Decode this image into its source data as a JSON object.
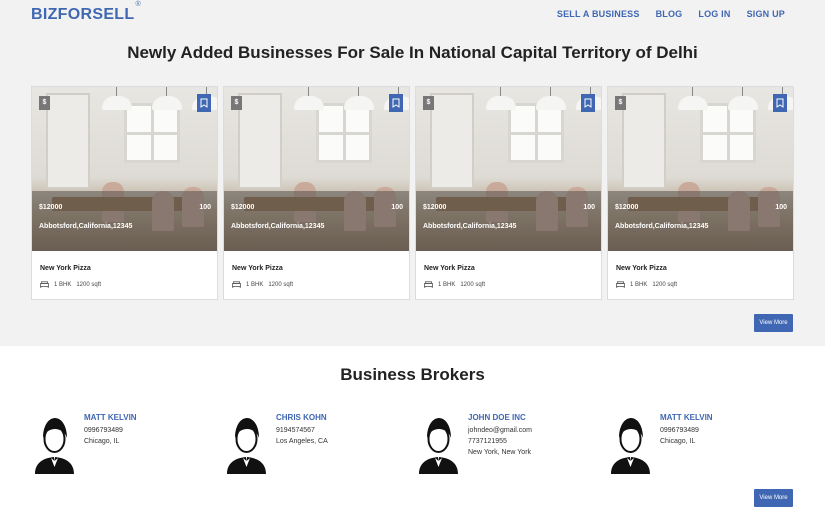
{
  "header": {
    "logo": "BIZFORSELL",
    "logo_mark": "®",
    "nav": [
      "SELL A BUSINESS",
      "BLOG",
      "LOG IN",
      "SIGN UP"
    ]
  },
  "listings": {
    "title": "Newly Added Businesses For Sale In National Capital Territory of Delhi",
    "cards": [
      {
        "badge": "$",
        "price": "$12000",
        "count": "100",
        "address": "Abbotsford,California,12345",
        "name": "New York Pizza",
        "bhk": "1 BHK",
        "area": "1200 sqft"
      },
      {
        "badge": "$",
        "price": "$12000",
        "count": "100",
        "address": "Abbotsford,California,12345",
        "name": "New York Pizza",
        "bhk": "1 BHK",
        "area": "1200 sqft"
      },
      {
        "badge": "$",
        "price": "$12000",
        "count": "100",
        "address": "Abbotsford,California,12345",
        "name": "New York Pizza",
        "bhk": "1 BHK",
        "area": "1200 sqft"
      },
      {
        "badge": "$",
        "price": "$12000",
        "count": "100",
        "address": "Abbotsford,California,12345",
        "name": "New York Pizza",
        "bhk": "1 BHK",
        "area": "1200 sqft"
      }
    ],
    "view_more": "View More"
  },
  "brokers": {
    "title": "Business Brokers",
    "items": [
      {
        "name": "MATT KELVIN",
        "lines": [
          "0996793489",
          "Chicago, IL"
        ]
      },
      {
        "name": "CHRIS KOHN",
        "lines": [
          "9194574567",
          "Los Angeles, CA"
        ]
      },
      {
        "name": "JOHN DOE INC",
        "lines": [
          "johndeo@gmail.com",
          "7737121955",
          "New York, New York"
        ]
      },
      {
        "name": "MATT KELVIN",
        "lines": [
          "0996793489",
          "Chicago, IL"
        ]
      }
    ],
    "view_more": "View More"
  },
  "colors": {
    "accent": "#3f67b3",
    "top_bg": "#f2f2f2"
  },
  "icons": [
    "bookmark-icon",
    "bed-icon",
    "person-avatar-icon"
  ]
}
